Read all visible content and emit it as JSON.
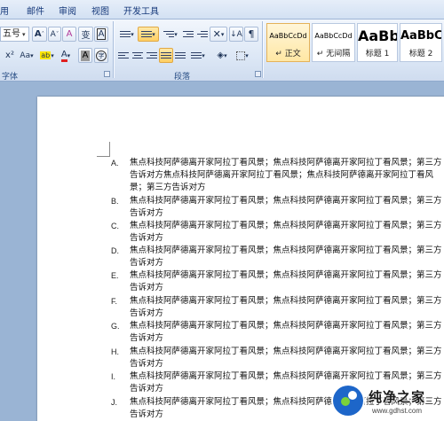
{
  "tabs": [
    {
      "label": "用"
    },
    {
      "label": "邮件"
    },
    {
      "label": "审阅"
    },
    {
      "label": "视图"
    },
    {
      "label": "开发工具"
    }
  ],
  "font": {
    "size_value": "五号",
    "group_label": "字体",
    "grow_label": "A",
    "shrink_label": "A",
    "clear_label": "A",
    "phonetic_label": "变",
    "border_label": "A",
    "superscript_label": "x²",
    "change_case_label": "Aa",
    "highlight_label": "ab",
    "font_color_label": "A",
    "shading_label": "A",
    "enclose_label": "字",
    "font_color_hex": "#e02020",
    "highlight_color_hex": "#ffe600"
  },
  "paragraph": {
    "group_label": "段落"
  },
  "styles": [
    {
      "sample": "AaBbCcDd",
      "name": "↵ 正文"
    },
    {
      "sample": "AaBbCcDd",
      "name": "↵ 无间隔"
    },
    {
      "sample": "AaBb",
      "name": "标题 1"
    },
    {
      "sample": "AaBbC",
      "name": "标题 2"
    }
  ],
  "document": {
    "items": [
      {
        "marker": "A.",
        "text": "焦点科技阿萨德离开家阿拉丁看风景；焦点科技阿萨德离开家阿拉丁看风景；第三方告诉对方焦点科技阿萨德离开家阿拉丁看风景；焦点科技阿萨德离开家阿拉丁看风景；第三方告诉对方"
      },
      {
        "marker": "B.",
        "text": "焦点科技阿萨德离开家阿拉丁看风景；焦点科技阿萨德离开家阿拉丁看风景；第三方告诉对方"
      },
      {
        "marker": "C.",
        "text": "焦点科技阿萨德离开家阿拉丁看风景；焦点科技阿萨德离开家阿拉丁看风景；第三方告诉对方"
      },
      {
        "marker": "D.",
        "text": "焦点科技阿萨德离开家阿拉丁看风景；焦点科技阿萨德离开家阿拉丁看风景；第三方告诉对方"
      },
      {
        "marker": "E.",
        "text": "焦点科技阿萨德离开家阿拉丁看风景；焦点科技阿萨德离开家阿拉丁看风景；第三方告诉对方"
      },
      {
        "marker": "F.",
        "text": "焦点科技阿萨德离开家阿拉丁看风景；焦点科技阿萨德离开家阿拉丁看风景；第三方告诉对方"
      },
      {
        "marker": "G.",
        "text": "焦点科技阿萨德离开家阿拉丁看风景；焦点科技阿萨德离开家阿拉丁看风景；第三方告诉对方"
      },
      {
        "marker": "H.",
        "text": "焦点科技阿萨德离开家阿拉丁看风景；焦点科技阿萨德离开家阿拉丁看风景；第三方告诉对方"
      },
      {
        "marker": "I.",
        "text": "焦点科技阿萨德离开家阿拉丁看风景；焦点科技阿萨德离开家阿拉丁看风景；第三方告诉对方"
      },
      {
        "marker": "J.",
        "text": "焦点科技阿萨德离开家阿拉丁看风景；焦点科技阿萨德离开家阿拉丁看风景；第三方告诉对方"
      }
    ]
  },
  "watermark": {
    "title": "纯净之家",
    "url": "www.gdhst.com"
  }
}
